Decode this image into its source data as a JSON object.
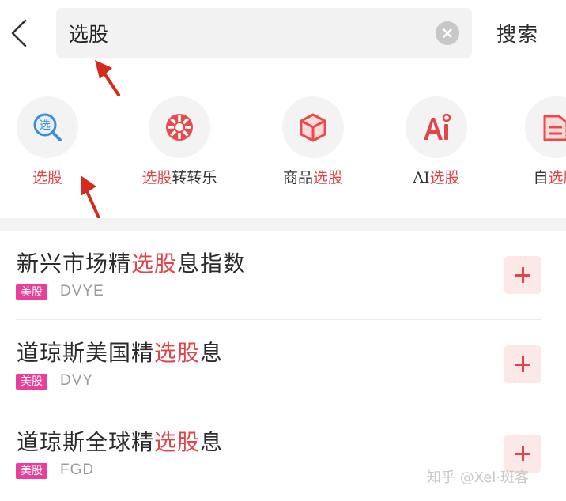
{
  "search": {
    "value": "选股",
    "submit_label": "搜索"
  },
  "features": [
    {
      "icon": "stock-picker-search-icon",
      "parts": [
        {
          "t": "选股",
          "hl": true
        }
      ]
    },
    {
      "icon": "wheel-icon",
      "parts": [
        {
          "t": "选股",
          "hl": true
        },
        {
          "t": "转转乐",
          "hl": false
        }
      ]
    },
    {
      "icon": "box-icon",
      "parts": [
        {
          "t": "商品",
          "hl": false
        },
        {
          "t": "选股",
          "hl": true
        }
      ]
    },
    {
      "icon": "ai-icon",
      "parts": [
        {
          "t": "AI",
          "hl": false
        },
        {
          "t": "选股",
          "hl": true
        }
      ]
    },
    {
      "icon": "folder-icon",
      "parts": [
        {
          "t": "自",
          "hl": false
        },
        {
          "t": "选股",
          "hl": true
        }
      ]
    }
  ],
  "results": [
    {
      "title_pre": "新兴市场精",
      "title_hl": "选股",
      "title_post": "息指数",
      "tag": "美股",
      "ticker": "DVYE"
    },
    {
      "title_pre": "道琼斯美国精",
      "title_hl": "选股",
      "title_post": "息",
      "tag": "美股",
      "ticker": "DVY"
    },
    {
      "title_pre": "道琼斯全球精",
      "title_hl": "选股",
      "title_post": "息",
      "tag": "美股",
      "ticker": "FGD"
    }
  ],
  "watermark": "知乎 @Xel·斑客",
  "colors": {
    "accent": "#e0454a",
    "tag_bg": "#e8409a",
    "search_bg": "#f2f2f2",
    "add_button_bg": "#fde8e8",
    "annotation_arrow": "#d42b1c"
  }
}
